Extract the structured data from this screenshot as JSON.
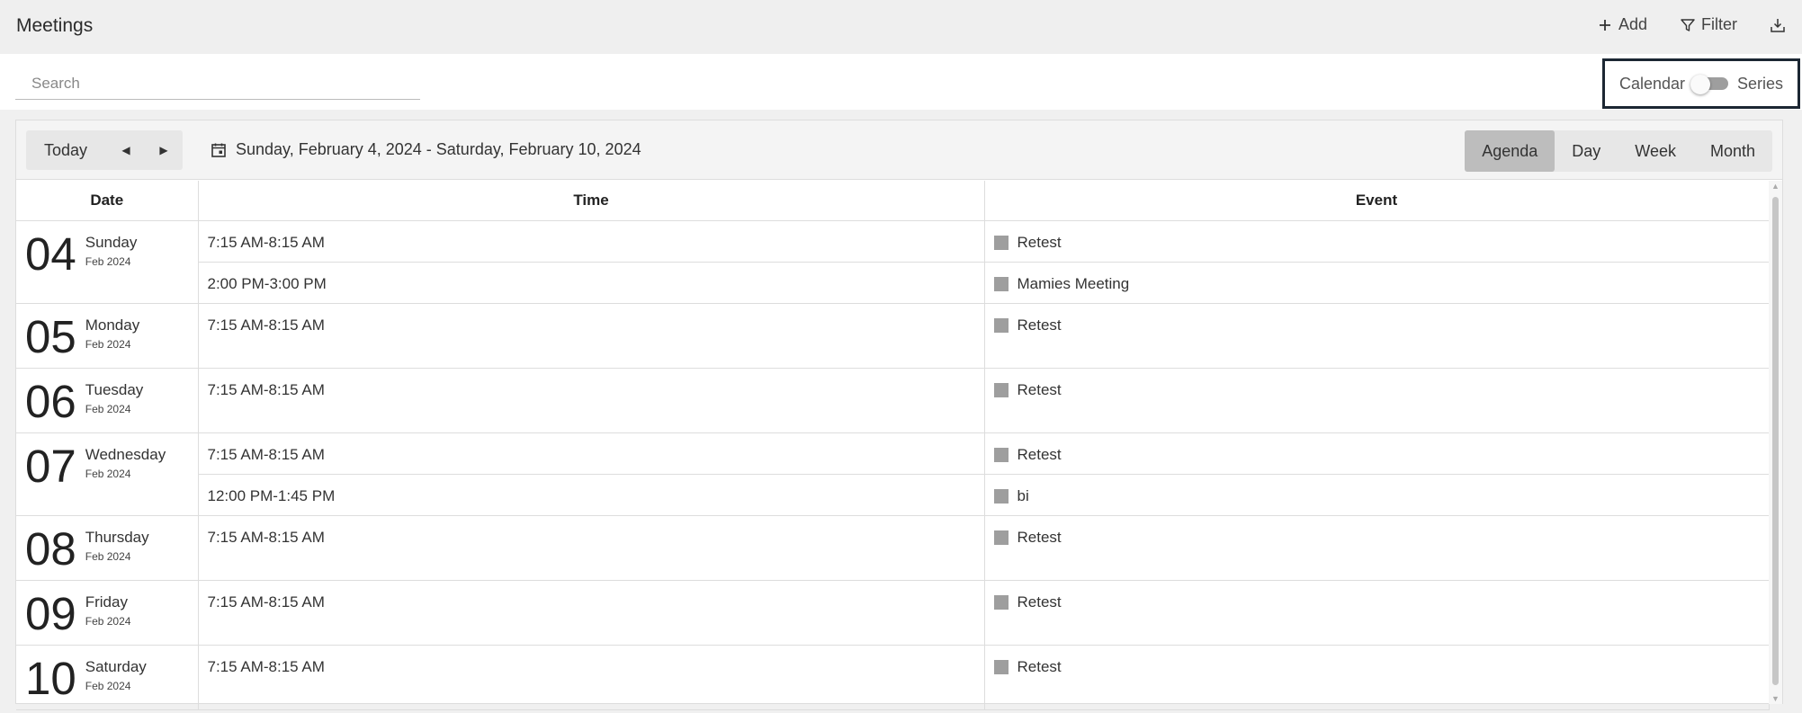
{
  "header": {
    "title": "Meetings",
    "add_label": "Add",
    "filter_label": "Filter"
  },
  "search": {
    "placeholder": "Search"
  },
  "mode_toggle": {
    "left_label": "Calendar",
    "right_label": "Series",
    "is_series": false
  },
  "toolbar": {
    "today_label": "Today",
    "date_range": "Sunday, February 4, 2024 - Saturday, February 10, 2024",
    "views": [
      "Agenda",
      "Day",
      "Week",
      "Month"
    ],
    "active_view": "Agenda"
  },
  "agenda": {
    "columns": [
      "Date",
      "Time",
      "Event"
    ],
    "days": [
      {
        "day": "04",
        "weekday": "Sunday",
        "month": "Feb 2024",
        "events": [
          {
            "time": "7:15 AM-8:15 AM",
            "title": "Retest"
          },
          {
            "time": "2:00 PM-3:00 PM",
            "title": "Mamies Meeting"
          }
        ]
      },
      {
        "day": "05",
        "weekday": "Monday",
        "month": "Feb 2024",
        "events": [
          {
            "time": "7:15 AM-8:15 AM",
            "title": "Retest"
          }
        ]
      },
      {
        "day": "06",
        "weekday": "Tuesday",
        "month": "Feb 2024",
        "events": [
          {
            "time": "7:15 AM-8:15 AM",
            "title": "Retest"
          }
        ]
      },
      {
        "day": "07",
        "weekday": "Wednesday",
        "month": "Feb 2024",
        "events": [
          {
            "time": "7:15 AM-8:15 AM",
            "title": "Retest"
          },
          {
            "time": "12:00 PM-1:45 PM",
            "title": "bi"
          }
        ]
      },
      {
        "day": "08",
        "weekday": "Thursday",
        "month": "Feb 2024",
        "events": [
          {
            "time": "7:15 AM-8:15 AM",
            "title": "Retest"
          }
        ]
      },
      {
        "day": "09",
        "weekday": "Friday",
        "month": "Feb 2024",
        "events": [
          {
            "time": "7:15 AM-8:15 AM",
            "title": "Retest"
          }
        ]
      },
      {
        "day": "10",
        "weekday": "Saturday",
        "month": "Feb 2024",
        "events": [
          {
            "time": "7:15 AM-8:15 AM",
            "title": "Retest"
          }
        ]
      }
    ]
  },
  "colors": {
    "event_swatch": "#9e9e9e",
    "focus_border": "#1c2733",
    "active_view_bg": "#bdbdbd"
  }
}
